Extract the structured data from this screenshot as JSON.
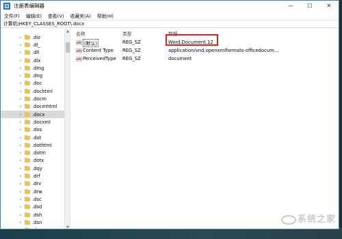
{
  "window": {
    "title": "注册表编辑器",
    "controls": [
      "—",
      "☐",
      "✕"
    ]
  },
  "menu": [
    "文件(F)",
    "编辑(E)",
    "查看(V)",
    "收藏夹(A)",
    "帮助(H)"
  ],
  "address": "计算机\\HKEY_CLASSES_ROOT\\.docx",
  "tree": [
    {
      "label": ".diz",
      "selected": false
    },
    {
      "label": ".dl_",
      "selected": false
    },
    {
      "label": ".dll",
      "selected": false
    },
    {
      "label": ".dlx",
      "selected": false
    },
    {
      "label": ".dmg",
      "selected": false
    },
    {
      "label": ".dng",
      "selected": false
    },
    {
      "label": ".doc",
      "selected": false
    },
    {
      "label": ".dochtml",
      "selected": false
    },
    {
      "label": ".docm",
      "selected": false
    },
    {
      "label": ".docmhtml",
      "selected": false
    },
    {
      "label": ".docx",
      "selected": true
    },
    {
      "label": ".docxml",
      "selected": false
    },
    {
      "label": ".dos",
      "selected": false
    },
    {
      "label": ".dot",
      "selected": false
    },
    {
      "label": ".dothtml",
      "selected": false
    },
    {
      "label": ".dotm",
      "selected": false
    },
    {
      "label": ".dotx",
      "selected": false
    },
    {
      "label": ".dqy",
      "selected": false
    },
    {
      "label": ".drf",
      "selected": false
    },
    {
      "label": ".drv",
      "selected": false
    },
    {
      "label": ".drw",
      "selected": false
    },
    {
      "label": ".dsc",
      "selected": false
    },
    {
      "label": ".dsd",
      "selected": false
    },
    {
      "label": ".dsh",
      "selected": false
    },
    {
      "label": ".dsn",
      "selected": false
    },
    {
      "label": ".dsp",
      "selected": false
    }
  ],
  "columns": {
    "name": "名称",
    "type": "类型",
    "data": "数据"
  },
  "values": [
    {
      "name": "(默认)",
      "type": "REG_SZ",
      "data": "Word.Document.12"
    },
    {
      "name": "Content Type",
      "type": "REG_SZ",
      "data": "application/vnd.openxmlformats-officedocum..."
    },
    {
      "name": "PerceivedType",
      "type": "REG_SZ",
      "data": "document"
    }
  ],
  "value_icon_text": "ab",
  "watermark": "系统之家",
  "colors": {
    "highlight": "#e02020",
    "folder": "#e8c15a",
    "app_icon": "#1e73c8"
  }
}
